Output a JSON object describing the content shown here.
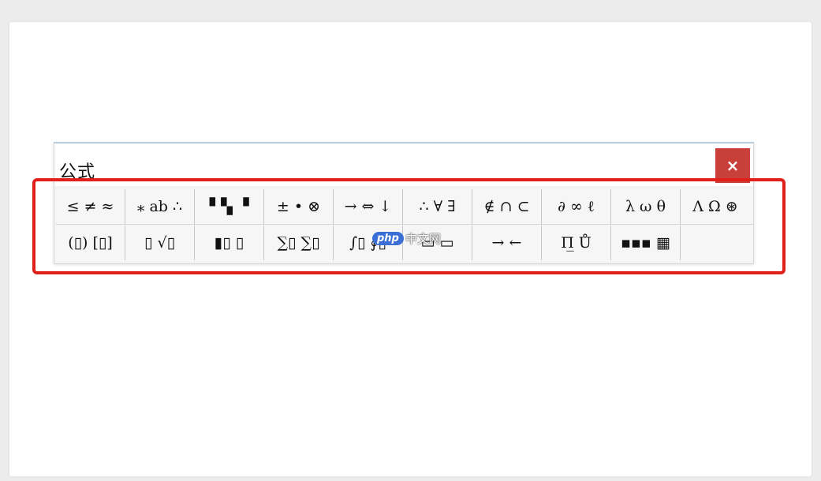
{
  "window": {
    "title": "公式",
    "close_glyph": "×"
  },
  "toolbar": {
    "row1": [
      "≤ ≠ ≈",
      "⁎ ab ∴",
      "▘▚ ▝",
      "± • ⊗",
      "→ ⇔ ↓",
      "∴ ∀ ∃",
      "∉ ∩ ⊂",
      "∂ ∞ ℓ",
      "λ ω θ",
      "Λ Ω ⊛"
    ],
    "row2": [
      "(▯) [▯]",
      "▯ √▯",
      "▮▯ ▯",
      "∑▯ ∑▯",
      "∫▯ ∮▯",
      "▭ ▭",
      "→ ←",
      "Π̲ Ů",
      "▪▪▪ ▦",
      ""
    ]
  },
  "watermark": {
    "logo": "php",
    "text": "中文网"
  },
  "colors": {
    "highlight_border": "#e0201b",
    "close_button": "#c9403b",
    "watermark_logo": "#3b6fd6"
  },
  "icons": {
    "close": "close-icon"
  }
}
